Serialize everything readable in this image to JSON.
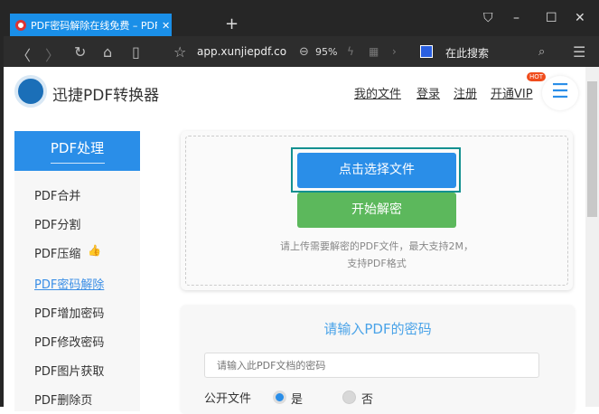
{
  "browser": {
    "tab_title": "PDF密码解除在线免费 – PDF密码移除",
    "url": "app.xunjiepdf.co",
    "zoom": "95%",
    "search_label": "在此搜索"
  },
  "header": {
    "brand": "迅捷PDF转换器",
    "links": [
      "我的文件",
      "登录",
      "注册",
      "开通VIP"
    ],
    "hot_badge": "HOT"
  },
  "sidebar": {
    "title": "PDF处理",
    "items": [
      {
        "label": "PDF合并"
      },
      {
        "label": "PDF分割"
      },
      {
        "label": "PDF压缩"
      },
      {
        "label": "PDF密码解除",
        "active": true
      },
      {
        "label": "PDF增加密码"
      },
      {
        "label": "PDF修改密码"
      },
      {
        "label": "PDF图片获取"
      },
      {
        "label": "PDF删除页"
      }
    ]
  },
  "upload": {
    "select_button": "点击选择文件",
    "start_button": "开始解密",
    "hint_line1": "请上传需要解密的PDF文件，最大支持2M，",
    "hint_line2": "支持PDF格式"
  },
  "password": {
    "title": "请输入PDF的密码",
    "placeholder": "请输入此PDF文档的密码",
    "public_label": "公开文件",
    "option_yes": "是",
    "option_no": "否",
    "selected": "是"
  },
  "colors": {
    "tab": "#1a8fe8",
    "primary": "#2a8ee8",
    "green": "#5cb85c",
    "outline": "#139090"
  }
}
